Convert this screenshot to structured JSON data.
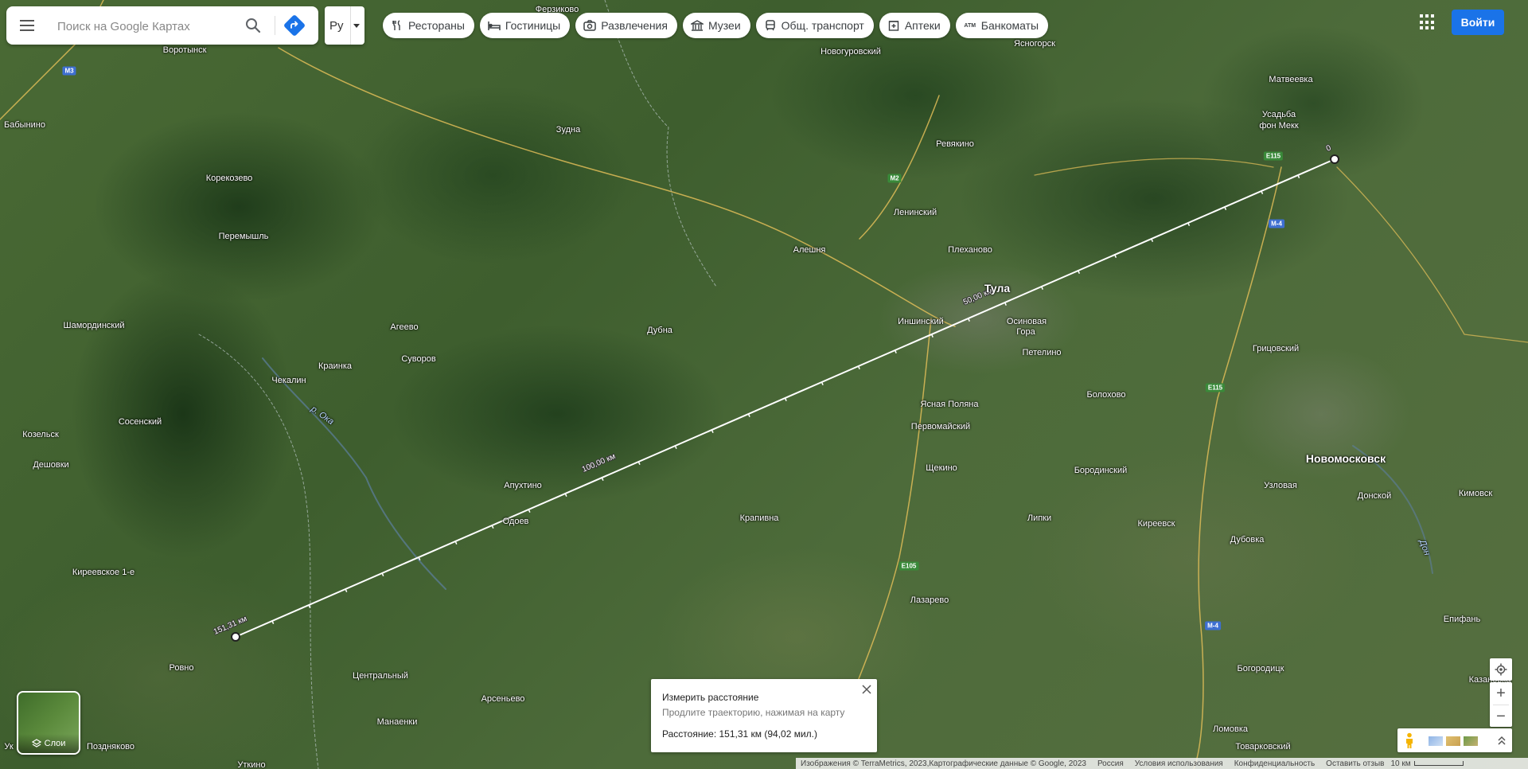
{
  "search": {
    "placeholder": "Поиск на Google Картах"
  },
  "language": {
    "code": "Ру"
  },
  "chips": [
    {
      "icon": "restaurant-icon",
      "label": "Рестораны"
    },
    {
      "icon": "hotel-icon",
      "label": "Гостиницы"
    },
    {
      "icon": "camera-icon",
      "label": "Развлечения"
    },
    {
      "icon": "museum-icon",
      "label": "Музеи"
    },
    {
      "icon": "transit-icon",
      "label": "Общ. транспорт"
    },
    {
      "icon": "pharmacy-icon",
      "label": "Аптеки"
    },
    {
      "icon": "atm-icon",
      "label": "Банкоматы"
    }
  ],
  "chip_atm_glyph": "ATM",
  "header": {
    "signin_label": "Войти"
  },
  "layers": {
    "label": "Слои"
  },
  "measure": {
    "title": "Измерить расстояние",
    "hint": "Продлите траекторию, нажимая на карту",
    "distance": "Расстояние: 151,31 км (94,02 мил.)"
  },
  "zoom": {
    "in": "+",
    "out": "−"
  },
  "route": {
    "marker_labels": [
      "50,00 км",
      "100,00 км",
      "151,31 км"
    ],
    "end_label": "0"
  },
  "footer": {
    "attribution": "Изображения © TerraMetrics, 2023,Картографические данные © Google, 2023",
    "country": "Россия",
    "terms": "Условия использования",
    "privacy": "Конфиденциальность",
    "feedback": "Оставить отзыв",
    "scale": "10 км"
  },
  "places": [
    {
      "name": "Ферзиково"
    },
    {
      "name": "Воротынск"
    },
    {
      "name": "Новогуровский"
    },
    {
      "name": "Ясногорск"
    },
    {
      "name": "Матвеевка"
    },
    {
      "name": "Усадьба"
    },
    {
      "name": "фон Мекк"
    },
    {
      "name": "Бабынино"
    },
    {
      "name": "Зудна"
    },
    {
      "name": "Ревякино"
    },
    {
      "name": "Корекозево"
    },
    {
      "name": "Ленинский"
    },
    {
      "name": "Перемышль"
    },
    {
      "name": "Алешня"
    },
    {
      "name": "Плеханово"
    },
    {
      "name": "Тула",
      "big": true
    },
    {
      "name": "Шамординский"
    },
    {
      "name": "Агеево"
    },
    {
      "name": "Дубна"
    },
    {
      "name": "Иншинский"
    },
    {
      "name": "Осиновая"
    },
    {
      "name": "Гора"
    },
    {
      "name": "Грицовский"
    },
    {
      "name": "Петелино"
    },
    {
      "name": "Краинка"
    },
    {
      "name": "Суворов"
    },
    {
      "name": "Чекалин"
    },
    {
      "name": "Болохово"
    },
    {
      "name": "Ясная Поляна"
    },
    {
      "name": "Козельск"
    },
    {
      "name": "Сосенский"
    },
    {
      "name": "Первомайский"
    },
    {
      "name": "Новомосковск",
      "big": true
    },
    {
      "name": "Дешовки"
    },
    {
      "name": "Щекино"
    },
    {
      "name": "Бородинский"
    },
    {
      "name": "Апухтино"
    },
    {
      "name": "Узловая"
    },
    {
      "name": "Донской"
    },
    {
      "name": "Кимовск"
    },
    {
      "name": "Одоев"
    },
    {
      "name": "Крапивна"
    },
    {
      "name": "Липки"
    },
    {
      "name": "Киреевск"
    },
    {
      "name": "Дубовка"
    },
    {
      "name": "Киреевское 1-е"
    },
    {
      "name": "Лазарево"
    },
    {
      "name": "Епифань"
    },
    {
      "name": "Ровно"
    },
    {
      "name": "Богородицк"
    },
    {
      "name": "Центральный"
    },
    {
      "name": "Казановка"
    },
    {
      "name": "Арсеньево"
    },
    {
      "name": "Манаенки"
    },
    {
      "name": "Ломовка"
    },
    {
      "name": "Поздняково"
    },
    {
      "name": "Товарковский"
    },
    {
      "name": "Уткино"
    },
    {
      "name": "Ук"
    }
  ],
  "rivers": [
    {
      "name": "р. Ока"
    },
    {
      "name": "Дон"
    }
  ],
  "roads": [
    {
      "label": "M3",
      "color": "blue"
    },
    {
      "label": "M2",
      "color": "green"
    },
    {
      "label": "E115",
      "color": "green"
    },
    {
      "label": "M-4",
      "color": "blue"
    },
    {
      "label": "E115",
      "color": "green"
    },
    {
      "label": "E105",
      "color": "green"
    },
    {
      "label": "M-4",
      "color": "blue"
    }
  ],
  "colors": {
    "accent": "#1a73e8",
    "route": "#ffffff"
  }
}
